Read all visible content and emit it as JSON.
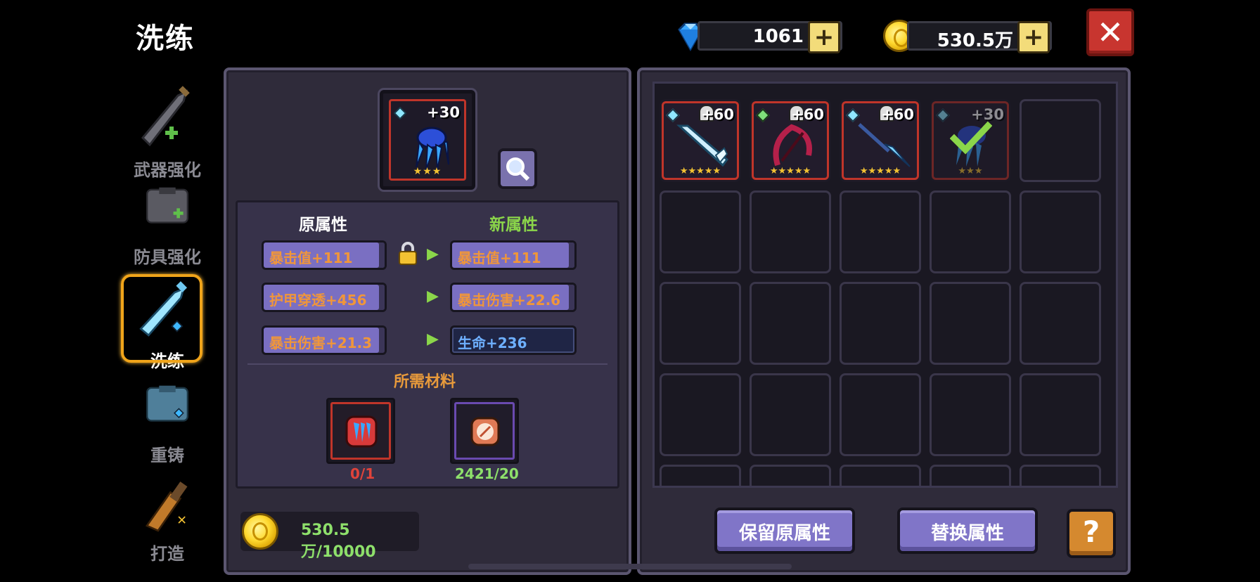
{
  "header": {
    "title": "洗练",
    "gems": "1061",
    "gold": "530.5万",
    "plus_symbol": "+",
    "close_symbol": "✕"
  },
  "sidebar": {
    "items": [
      {
        "label": "武器强化",
        "icon": "sword-upgrade-icon",
        "active": false
      },
      {
        "label": "防具强化",
        "icon": "armor-upgrade-icon",
        "active": false
      },
      {
        "label": "洗练",
        "icon": "refine-sword-icon",
        "active": true
      },
      {
        "label": "重铸",
        "icon": "reforge-armor-icon",
        "active": false
      },
      {
        "label": "打造",
        "icon": "forge-icon",
        "active": false
      }
    ]
  },
  "selected_item": {
    "level": "+30",
    "stars": "★★★",
    "icon": "blue-claw-icon"
  },
  "attributes": {
    "old_header": "原属性",
    "new_header": "新属性",
    "old": [
      "暴击值+111",
      "护甲穿透+456",
      "暴击伤害+21.3"
    ],
    "new": [
      "暴击值+111",
      "暴击伤害+22.6",
      "生命+236"
    ]
  },
  "materials": {
    "title": "所需材料",
    "items": [
      {
        "icon": "claw-material-icon",
        "count": "0/1"
      },
      {
        "icon": "scroll-material-icon",
        "count": "2421/20"
      }
    ]
  },
  "gold_cost": "530.5万/10000",
  "inventory": {
    "items": [
      {
        "level": "+60",
        "stars": "★★★★★",
        "icon": "ice-sword-icon",
        "gem_color": "#8fe7ff"
      },
      {
        "level": "+60",
        "stars": "★★★★★",
        "icon": "crimson-bow-icon",
        "gem_color": "#7fe07a"
      },
      {
        "level": "+60",
        "stars": "★★★★★",
        "icon": "ice-spear-icon",
        "gem_color": "#8fe7ff"
      },
      {
        "level": "+30",
        "stars": "★★★",
        "icon": "blue-claw-icon",
        "gem_color": "#8fe7ff",
        "selected": true
      }
    ]
  },
  "buttons": {
    "keep": "保留原属性",
    "replace": "替换属性",
    "help": "?"
  },
  "colors": {
    "panel": "#2f2b3a",
    "accent_orange": "#f0963a",
    "accent_green": "#8bd64a",
    "button_purple": "#8075c8",
    "close_red": "#c8352f"
  }
}
